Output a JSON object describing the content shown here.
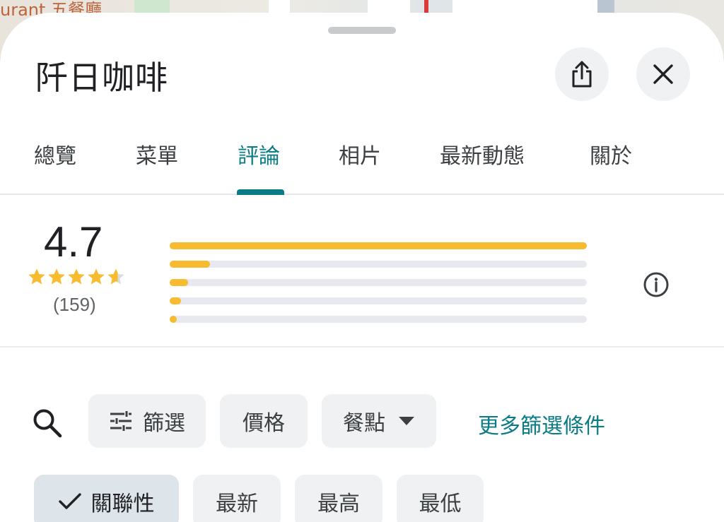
{
  "map": {
    "partial_label": "urant 五餐廳"
  },
  "header": {
    "title": "阡日咖啡",
    "share_icon": "share-icon",
    "close_icon": "close-icon"
  },
  "tabs": [
    {
      "label": "總覽",
      "active": false
    },
    {
      "label": "菜單",
      "active": false
    },
    {
      "label": "評論",
      "active": true
    },
    {
      "label": "相片",
      "active": false
    },
    {
      "label": "最新動態",
      "active": false
    },
    {
      "label": "關於",
      "active": false
    }
  ],
  "rating": {
    "score": "4.7",
    "stars": 4.7,
    "count": "(159)",
    "distribution": [
      {
        "stars": 5,
        "fraction": 1.0
      },
      {
        "stars": 4,
        "fraction": 0.097
      },
      {
        "stars": 3,
        "fraction": 0.044
      },
      {
        "stars": 2,
        "fraction": 0.027
      },
      {
        "stars": 1,
        "fraction": 0.017
      }
    ],
    "star_color": "#f6bb2e"
  },
  "filters": {
    "search_icon": "search-icon",
    "chips": [
      {
        "label": "篩選",
        "icon": "tune-icon"
      },
      {
        "label": "價格"
      },
      {
        "label": "餐點",
        "dropdown": true
      }
    ],
    "more": "更多篩選條件"
  },
  "sort": {
    "chips": [
      {
        "label": "關聯性",
        "selected": true
      },
      {
        "label": "最新",
        "selected": false
      },
      {
        "label": "最高",
        "selected": false
      },
      {
        "label": "最低",
        "selected": false
      }
    ]
  },
  "colors": {
    "accent": "#0b7c86",
    "bar_fill": "#f6bb2e",
    "bar_track": "#e8e9ee"
  }
}
